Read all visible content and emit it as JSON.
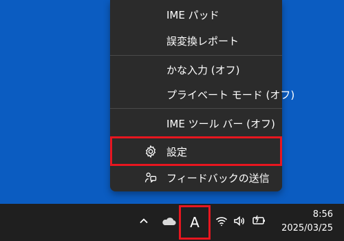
{
  "menu": {
    "items": [
      {
        "label": "IME パッド"
      },
      {
        "label": "誤変換レポート"
      },
      {
        "label": "かな入力 (オフ)"
      },
      {
        "label": "プライベート モード (オフ)"
      },
      {
        "label": "IME ツール バー (オフ)"
      },
      {
        "label": "設定",
        "icon": "gear-icon"
      },
      {
        "label": "フィードバックの送信",
        "icon": "feedback-icon"
      }
    ]
  },
  "taskbar": {
    "ime_mode": "A",
    "icons": [
      "chevron-up-icon",
      "onedrive-icon",
      "wifi-icon",
      "speaker-icon",
      "battery-icon"
    ],
    "clock": {
      "time": "8:56",
      "date": "2025/03/25"
    }
  },
  "colors": {
    "desktop": "#0b5cc1",
    "menu_bg": "#2b2b2b",
    "taskbar_bg": "#1f1f1f",
    "highlight": "#e8161f"
  }
}
